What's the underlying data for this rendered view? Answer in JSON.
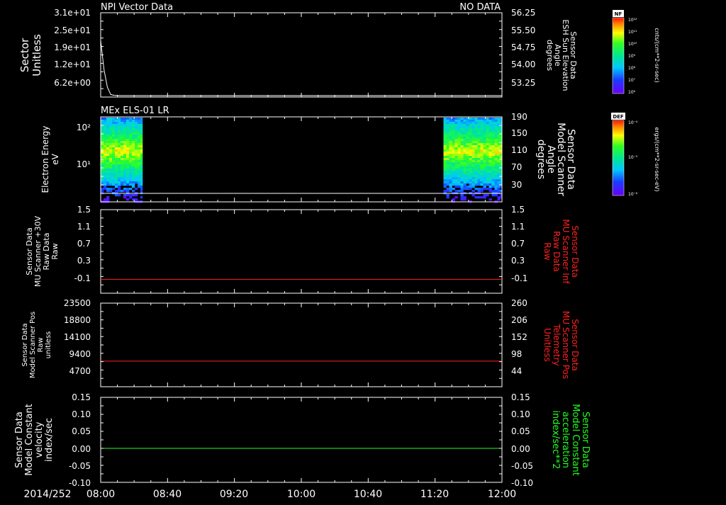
{
  "time_axis": {
    "date_label": "2014/252",
    "ticks": [
      "08:00",
      "08:40",
      "09:20",
      "10:00",
      "10:40",
      "11:20",
      "12:00"
    ]
  },
  "panels": [
    {
      "id": "npi",
      "title": "NPI Vector Data",
      "title_right": "NO DATA",
      "left_label": [
        "Sector",
        "Unitless"
      ],
      "right_label": [
        "Sensor Data",
        "ESH Sun Elevation",
        "Angle",
        "degrees"
      ],
      "left_ticks": [
        "3.1e+01",
        "2.5e+01",
        "1.9e+01",
        "1.2e+01",
        "6.2e+00"
      ],
      "right_ticks": [
        "56.25",
        "55.50",
        "54.75",
        "54.00",
        "53.25"
      ],
      "right_label_color": "#ffffff"
    },
    {
      "id": "els",
      "title": "MEx ELS-01 LR",
      "left_label": [
        "Electron Energy",
        "eV"
      ],
      "right_label": [
        "Sensor Data",
        "Model Scanner",
        "Angle",
        "degrees"
      ],
      "left_ticks": [
        "10²",
        "10¹"
      ],
      "right_ticks": [
        "190",
        "150",
        "110",
        "70",
        "30"
      ],
      "right_label_color": "#ffffff"
    },
    {
      "id": "mu_raw",
      "left_label": [
        "Sensor Data",
        "MU Scanner +30V",
        "Raw Data",
        "Raw"
      ],
      "right_label": [
        "Sensor Data",
        "MU Scanner Inf",
        "Raw Data",
        "Raw"
      ],
      "left_ticks": [
        "1.5",
        "1.1",
        "0.7",
        "0.3",
        "-0.1"
      ],
      "right_ticks": [
        "1.5",
        "1.1",
        "0.7",
        "0.3",
        "-0.1"
      ],
      "right_label_color": "#ff2020"
    },
    {
      "id": "scanner_pos",
      "left_label": [
        "Sensor Data",
        "Model Scanner Pos",
        "Raw",
        "unitless"
      ],
      "right_label": [
        "Sensor Data",
        "MU Scanner Pos",
        "Telemetry",
        "Unitless"
      ],
      "left_ticks": [
        "23500",
        "18800",
        "14100",
        "9400",
        "4700"
      ],
      "right_ticks": [
        "260",
        "206",
        "152",
        "98",
        "44"
      ],
      "right_label_color": "#ff2020"
    },
    {
      "id": "constant",
      "left_label": [
        "Sensor Data",
        "Model Constant",
        "velocity",
        "index/sec"
      ],
      "right_label": [
        "Sensor Data",
        "Model Constant",
        "acceleration",
        "index/sec**2"
      ],
      "left_ticks": [
        "0.15",
        "0.10",
        "0.05",
        "0.00",
        "-0.05",
        "-0.10"
      ],
      "right_ticks": [
        "0.15",
        "0.10",
        "0.05",
        "0.00",
        "-0.05",
        "-0.10"
      ],
      "right_label_color": "#20ff20"
    }
  ],
  "colorbars": [
    {
      "id": "nf",
      "label": "NF",
      "unit": "cnts/(cm**2-sr-sec)",
      "ticks": [
        "10¹²",
        "10¹¹",
        "10¹⁰",
        "10⁹",
        "10⁸",
        "10⁷",
        "10⁶"
      ]
    },
    {
      "id": "def",
      "label": "DEF",
      "unit": "ergs/(cm**2-sr-sec-eV)",
      "ticks": [
        "10⁻⁴",
        "10⁻⁵",
        "10⁻⁶"
      ]
    }
  ],
  "chart_data": [
    {
      "type": "line",
      "panel": "npi",
      "ylabel": "Sector Unitless",
      "ylim": [
        3.1,
        31
      ],
      "x": [
        "08:00",
        "08:02",
        "08:04",
        "08:06",
        "08:08",
        "08:12",
        "12:00"
      ],
      "series": [
        {
          "values": [
            22,
            12,
            6,
            3.5,
            3.2,
            3.1,
            3.1
          ]
        }
      ],
      "line_color": "#ffffff"
    },
    {
      "type": "heatmap",
      "panel": "els",
      "ylabel": "Electron Energy eV",
      "x_intervals_with_data": [
        [
          "08:00",
          "08:25"
        ],
        [
          "11:25",
          "12:00"
        ]
      ],
      "energy_range_ev": [
        1,
        200
      ],
      "peak_energy_ev": 25,
      "line_color": "#ffffff"
    },
    {
      "type": "line",
      "panel": "mu_raw",
      "ylim": [
        -0.3,
        1.5
      ],
      "x": [
        "08:00",
        "12:00"
      ],
      "series": [
        {
          "values": [
            0.0,
            0.0
          ]
        }
      ],
      "line_color": "#ff2020"
    },
    {
      "type": "line",
      "panel": "scanner_pos",
      "ylim": [
        0,
        23500
      ],
      "x": [
        "08:00",
        "12:00"
      ],
      "series": [
        {
          "values": [
            7200,
            7200
          ]
        }
      ],
      "line_color": "#ff2020"
    },
    {
      "type": "line",
      "panel": "constant",
      "ylim": [
        -0.1,
        0.15
      ],
      "x": [
        "08:00",
        "12:00"
      ],
      "series": [
        {
          "values": [
            0.0,
            0.0
          ]
        }
      ],
      "line_color": "#20ff20"
    }
  ]
}
